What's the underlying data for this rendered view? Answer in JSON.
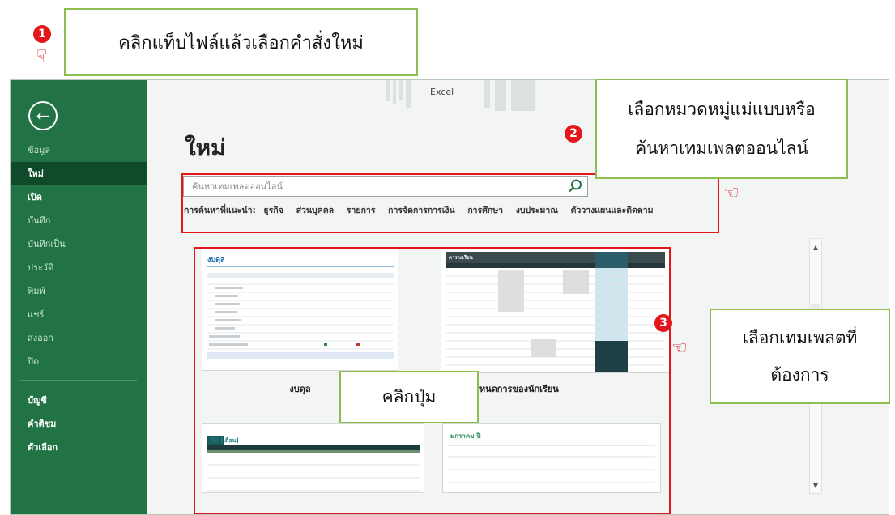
{
  "callouts": {
    "step1_text": "คลิกแท็บไฟล์แล้วเลือกคำสั่งใหม่",
    "step2_line1": "เลือกหมวดหมู่แม่แบบหรือ",
    "step2_line2": "ค้นหาเทมเพลตออนไลน์",
    "step3_line1": "เลือกเทมเพลตที่",
    "step3_line2": "ต้องการ",
    "click_button": "คลิกปุ่ม"
  },
  "badges": {
    "b1": "1",
    "b2": "2",
    "b3": "3"
  },
  "window": {
    "app_title": "Excel",
    "sidebar": {
      "items": [
        {
          "label": "ข้อมูล"
        },
        {
          "label": "ใหม่"
        },
        {
          "label": "เปิด"
        },
        {
          "label": "บันทึก"
        },
        {
          "label": "บันทึกเป็น"
        },
        {
          "label": "ประวัติ"
        },
        {
          "label": "พิมพ์"
        },
        {
          "label": "แชร์"
        },
        {
          "label": "ส่งออก"
        },
        {
          "label": "ปิด"
        }
      ],
      "bottom_items": [
        {
          "label": "บัญชี"
        },
        {
          "label": "คำติชม"
        },
        {
          "label": "ตัวเลือก"
        }
      ]
    },
    "page_title": "ใหม่",
    "search": {
      "placeholder": "ค้นหาเทมเพลตออนไลน์"
    },
    "suggested": {
      "label": "การค้นหาที่แนะนำ:",
      "items": [
        "ธุรกิจ",
        "ส่วนบุคคล",
        "รายการ",
        "การจัดการการเงิน",
        "การศึกษา",
        "งบประมาณ",
        "ตัววางแผนและติดตาม"
      ]
    },
    "templates": [
      {
        "name": "งบดุล",
        "thumb_title": "งบดุล"
      },
      {
        "name": "กำหนดการของนักเรียน",
        "thumb_title": "ตารางเรียน"
      },
      {
        "name": "",
        "thumb_title": "[ปี]   [เดือน]"
      },
      {
        "name": "",
        "thumb_title": "มกราคม ปี"
      }
    ]
  },
  "colors": {
    "excel_green": "#217346",
    "active_item": "#0f4b2a",
    "highlight_red": "#e3161b",
    "callout_border": "#8cbf4f"
  }
}
